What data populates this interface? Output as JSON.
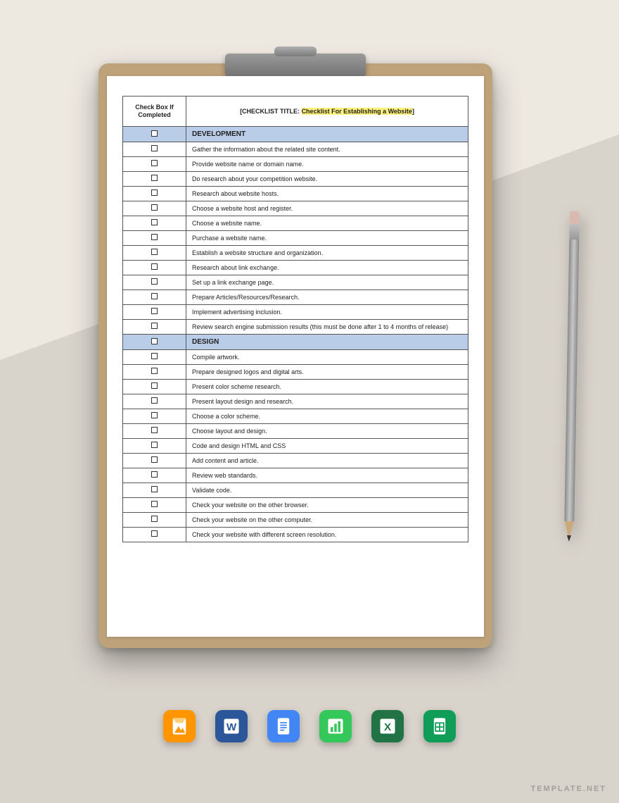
{
  "header": {
    "left_line1": "Check Box If",
    "left_line2": "Completed",
    "title_prefix": "[CHECKLIST TITLE: ",
    "title_highlight": "Checklist For Establishing a Website",
    "title_suffix": "]"
  },
  "sections": [
    {
      "label": "DEVELOPMENT",
      "items": [
        "Gather the information about the related site content.",
        "Provide website name or domain name.",
        "Do research about your competition website.",
        "Research about website hosts.",
        "Choose a website host and register.",
        "Choose a website name.",
        "Purchase a website name.",
        "Establish a website structure and organization.",
        "Research about link exchange.",
        "Set up a link exchange page.",
        "Prepare Articles/Resources/Research.",
        "Implement advertising inclusion.",
        "Review search engine submission results (this must be done after 1 to 4 months of release)"
      ]
    },
    {
      "label": "DESIGN",
      "items": [
        "Compile artwork.",
        "Prepare designed logos and digital arts.",
        "Present color scheme research.",
        "Present layout design and research.",
        "Choose a color scheme.",
        "Choose layout and design.",
        "Code and design HTML and CSS",
        "Add content and article.",
        "Review web standards.",
        "Validate code.",
        "Check your website on the other browser.",
        "Check your website on the other computer.",
        "Check your website with different screen resolution."
      ]
    }
  ],
  "formats": [
    {
      "name": "pages-icon",
      "bg": "#ff9500"
    },
    {
      "name": "word-icon",
      "bg": "#2b579a"
    },
    {
      "name": "gdocs-icon",
      "bg": "#4285f4"
    },
    {
      "name": "numbers-icon",
      "bg": "#34c759"
    },
    {
      "name": "excel-icon",
      "bg": "#217346"
    },
    {
      "name": "gsheets-icon",
      "bg": "#0f9d58"
    }
  ],
  "watermark": "TEMPLATE.NET"
}
